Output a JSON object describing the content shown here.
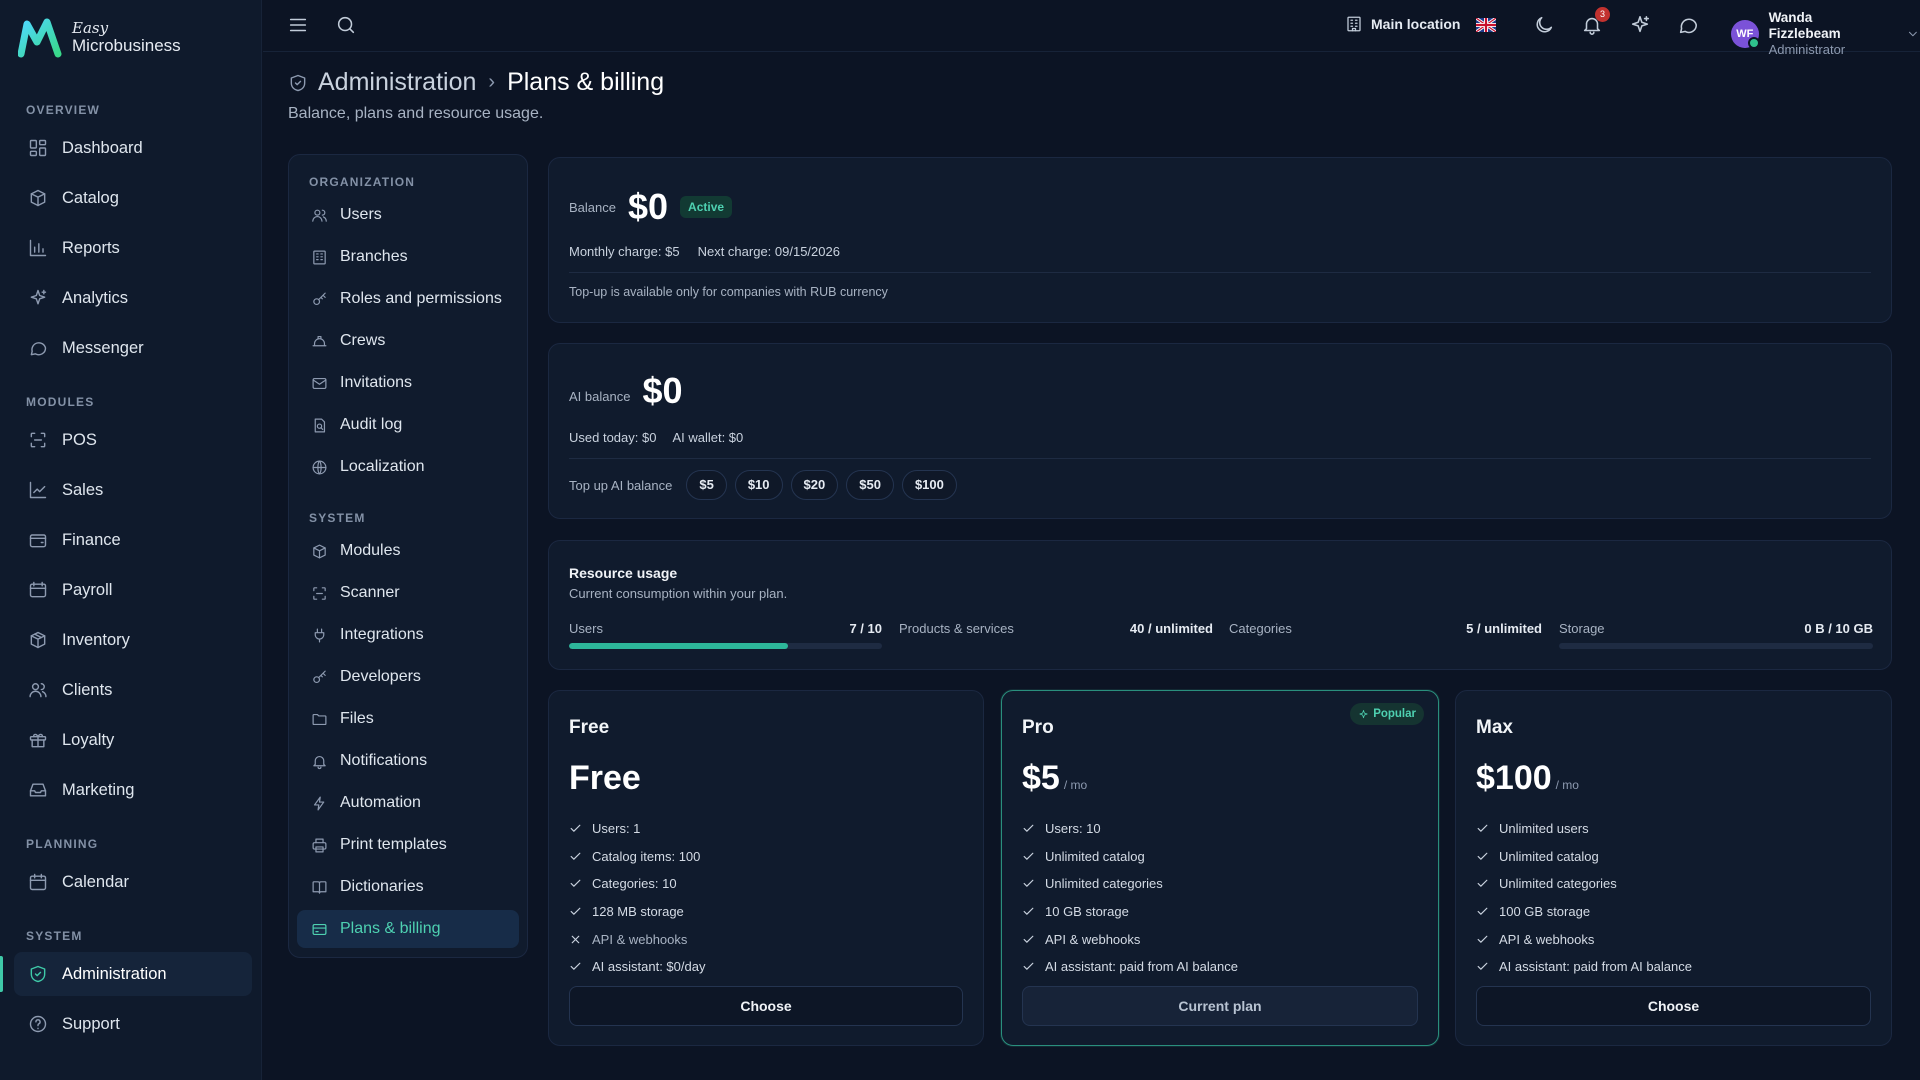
{
  "brand": {
    "easy": "Easy",
    "name": "Microbusiness"
  },
  "sidebar": {
    "sections": {
      "overview": "OVERVIEW",
      "modules": "MODULES",
      "planning": "PLANNING",
      "system": "SYSTEM"
    },
    "items": [
      {
        "label": "Dashboard",
        "icon": "dashboard-icon"
      },
      {
        "label": "Catalog",
        "icon": "catalog-icon"
      },
      {
        "label": "Reports",
        "icon": "reports-icon"
      },
      {
        "label": "Analytics",
        "icon": "sparkle-icon"
      },
      {
        "label": "Messenger",
        "icon": "chat-icon"
      },
      {
        "label": "POS",
        "icon": "scan-icon"
      },
      {
        "label": "Sales",
        "icon": "trend-icon"
      },
      {
        "label": "Finance",
        "icon": "wallet-icon"
      },
      {
        "label": "Payroll",
        "icon": "payroll-icon"
      },
      {
        "label": "Inventory",
        "icon": "box-icon"
      },
      {
        "label": "Clients",
        "icon": "users-icon"
      },
      {
        "label": "Loyalty",
        "icon": "gift-icon"
      },
      {
        "label": "Marketing",
        "icon": "inbox-icon"
      },
      {
        "label": "Calendar",
        "icon": "calendar-icon"
      },
      {
        "label": "Administration",
        "icon": "shield-icon",
        "active": true
      },
      {
        "label": "Support",
        "icon": "help-icon"
      }
    ]
  },
  "topbar": {
    "location": "Main location",
    "notifications_count": "3",
    "user": {
      "initials": "WF",
      "name": "Wanda Fizzlebeam",
      "role": "Administrator"
    }
  },
  "page": {
    "breadcrumb_parent": "Administration",
    "breadcrumb_sep": "›",
    "title": "Plans & billing",
    "subtitle": "Balance, plans and resource usage."
  },
  "subnav": {
    "sections": {
      "organization": "ORGANIZATION",
      "system": "SYSTEM"
    },
    "items": [
      {
        "label": "Users"
      },
      {
        "label": "Branches"
      },
      {
        "label": "Roles and permissions"
      },
      {
        "label": "Crews"
      },
      {
        "label": "Invitations"
      },
      {
        "label": "Audit log"
      },
      {
        "label": "Localization"
      },
      {
        "label": "Modules"
      },
      {
        "label": "Scanner"
      },
      {
        "label": "Integrations"
      },
      {
        "label": "Developers"
      },
      {
        "label": "Files"
      },
      {
        "label": "Notifications"
      },
      {
        "label": "Automation"
      },
      {
        "label": "Print templates"
      },
      {
        "label": "Dictionaries"
      },
      {
        "label": "Plans & billing",
        "active": true
      }
    ]
  },
  "balance": {
    "label": "Balance",
    "amount": "$0",
    "status": "Active",
    "monthly_charge": "Monthly charge: $5",
    "next_charge": "Next charge: 09/15/2026",
    "note": "Top-up is available only for companies with RUB currency"
  },
  "ai_balance": {
    "label": "AI balance",
    "amount": "$0",
    "used_today": "Used today: $0",
    "wallet": "AI wallet: $0",
    "topup_label": "Top up AI balance",
    "topup_options": [
      "$5",
      "$10",
      "$20",
      "$50",
      "$100"
    ]
  },
  "resource_usage": {
    "title": "Resource usage",
    "subtitle": "Current consumption within your plan.",
    "items": [
      {
        "label": "Users",
        "value": "7 / 10",
        "fraction": 0.7,
        "bar": true
      },
      {
        "label": "Products & services",
        "value": "40 / unlimited",
        "bar": false
      },
      {
        "label": "Categories",
        "value": "5 / unlimited",
        "bar": false
      },
      {
        "label": "Storage",
        "value": "0 B / 10 GB",
        "fraction": 0.0,
        "bar": true
      }
    ]
  },
  "plans": [
    {
      "name": "Free",
      "price": "Free",
      "per": "",
      "features": [
        {
          "text": "Users: 1",
          "included": true
        },
        {
          "text": "Catalog items: 100",
          "included": true
        },
        {
          "text": "Categories: 10",
          "included": true
        },
        {
          "text": "128 MB storage",
          "included": true
        },
        {
          "text": "API & webhooks",
          "included": false
        },
        {
          "text": "AI assistant: $0/day",
          "included": true
        }
      ],
      "button": "Choose"
    },
    {
      "name": "Pro",
      "price": "$5",
      "per": "/ mo",
      "badge": "Popular",
      "current": true,
      "features": [
        {
          "text": "Users: 10",
          "included": true
        },
        {
          "text": "Unlimited catalog",
          "included": true
        },
        {
          "text": "Unlimited categories",
          "included": true
        },
        {
          "text": "10 GB storage",
          "included": true
        },
        {
          "text": "API & webhooks",
          "included": true
        },
        {
          "text": "AI assistant: paid from AI balance",
          "included": true
        }
      ],
      "button": "Current plan"
    },
    {
      "name": "Max",
      "price": "$100",
      "per": "/ mo",
      "features": [
        {
          "text": "Unlimited users",
          "included": true
        },
        {
          "text": "Unlimited catalog",
          "included": true
        },
        {
          "text": "Unlimited categories",
          "included": true
        },
        {
          "text": "100 GB storage",
          "included": true
        },
        {
          "text": "API & webhooks",
          "included": true
        },
        {
          "text": "AI assistant: paid from AI balance",
          "included": true
        }
      ],
      "button": "Choose"
    }
  ],
  "colors": {
    "accent": "#3fc9a8",
    "background": "#0c1424",
    "card": "#101b2d"
  }
}
